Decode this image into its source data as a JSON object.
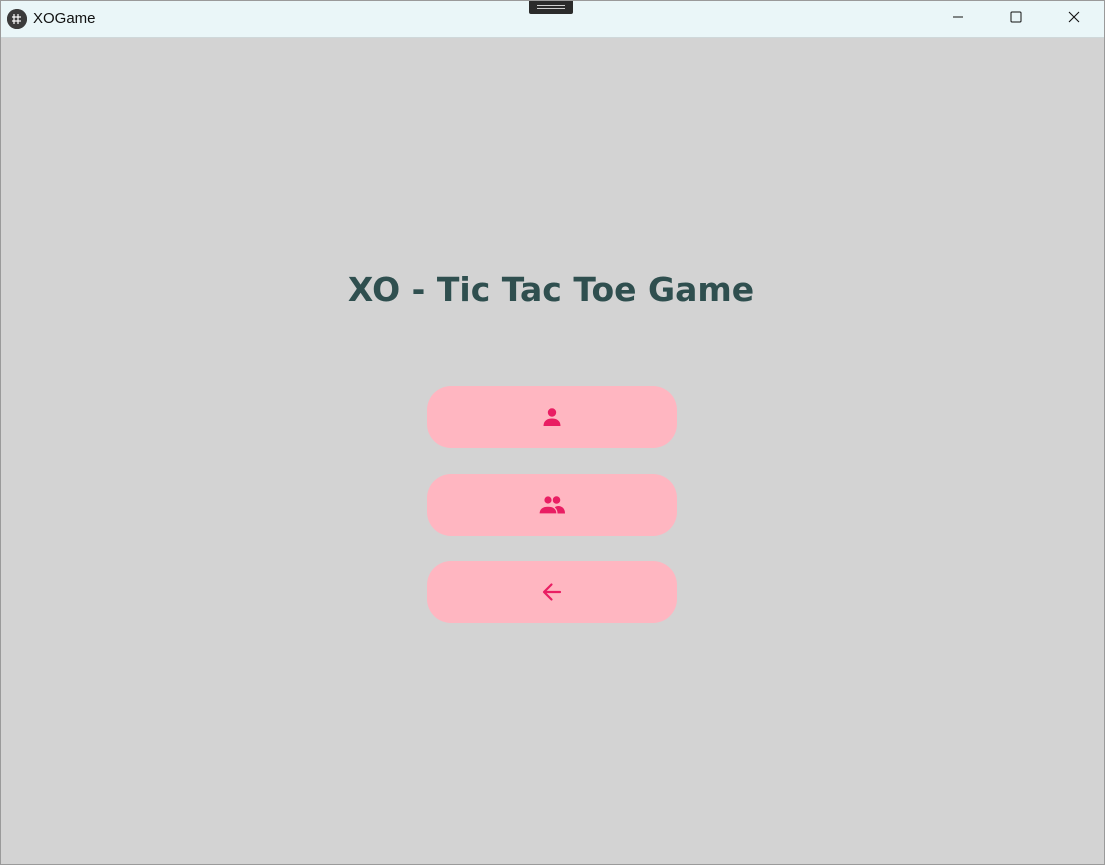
{
  "window": {
    "title": "XOGame",
    "icons": {
      "app": "app-icon",
      "minimize": "minimize-icon",
      "maximize": "maximize-icon",
      "close": "close-icon"
    }
  },
  "main": {
    "heading": "XO - Tic Tac Toe Game",
    "buttons": [
      {
        "icon": "single-player-icon"
      },
      {
        "icon": "two-players-icon"
      },
      {
        "icon": "back-arrow-icon"
      }
    ]
  },
  "colors": {
    "background": "#d3d3d3",
    "titlebar": "#eaf6f8",
    "heading": "#2f4f4f",
    "button_bg": "#ffb6c1",
    "button_icon": "#e91e63"
  }
}
